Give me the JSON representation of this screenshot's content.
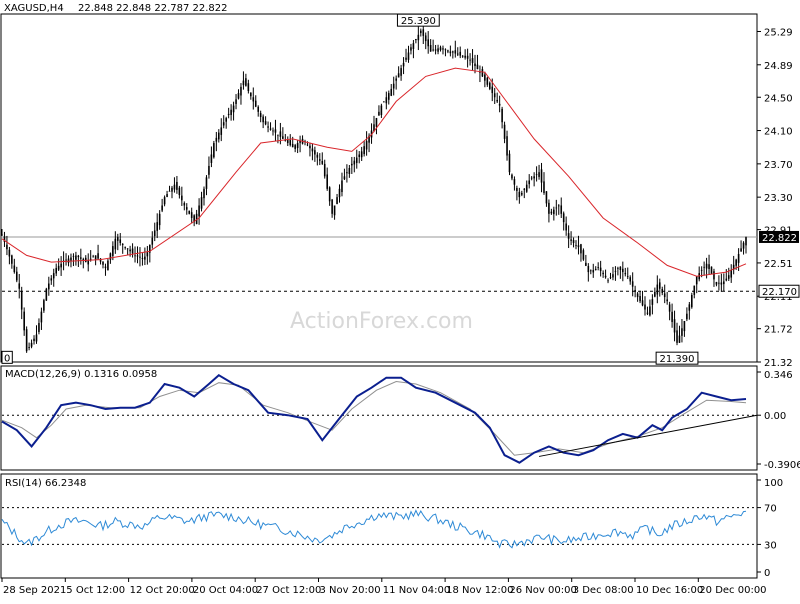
{
  "header": {
    "symbol": "XAGUSD,H4",
    "ohlc": "22.848 22.848 22.787 22.822"
  },
  "watermark": "ActionForex.com",
  "colors": {
    "candle": "#000000",
    "ma": "#d9262b",
    "macd_main": "#0b1f8f",
    "macd_signal": "#909090",
    "rsi": "#2e8ad6",
    "grid": "#808080",
    "trendline": "#000000",
    "last_price_box": "#000000"
  },
  "chart_data": [
    {
      "type": "candlestick",
      "name": "price",
      "title": "XAGUSD,H4",
      "ylim": [
        21.32,
        25.5
      ],
      "yticks": [
        25.29,
        24.89,
        24.5,
        24.1,
        23.7,
        23.3,
        22.91,
        22.51,
        22.11,
        21.72,
        21.32
      ],
      "xticks": [
        "28 Sep 2021",
        "5 Oct 12:00",
        "12 Oct 20:00",
        "20 Oct 04:00",
        "27 Oct 12:00",
        "3 Nov 20:00",
        "11 Nov 04:00",
        "18 Nov 12:00",
        "26 Nov 00:00",
        "3 Dec 08:00",
        "10 Dec 16:00",
        "20 Dec 00:00"
      ],
      "close_path": [
        [
          0,
          22.85
        ],
        [
          4,
          22.5
        ],
        [
          7,
          22.2
        ],
        [
          10,
          21.45
        ],
        [
          14,
          21.65
        ],
        [
          18,
          22.2
        ],
        [
          22,
          22.45
        ],
        [
          26,
          22.55
        ],
        [
          30,
          22.6
        ],
        [
          34,
          22.52
        ],
        [
          38,
          22.6
        ],
        [
          42,
          22.45
        ],
        [
          46,
          22.8
        ],
        [
          50,
          22.7
        ],
        [
          54,
          22.6
        ],
        [
          58,
          22.55
        ],
        [
          62,
          22.9
        ],
        [
          66,
          23.3
        ],
        [
          70,
          23.45
        ],
        [
          74,
          23.2
        ],
        [
          78,
          23.0
        ],
        [
          82,
          23.4
        ],
        [
          86,
          23.95
        ],
        [
          90,
          24.2
        ],
        [
          94,
          24.4
        ],
        [
          98,
          24.7
        ],
        [
          102,
          24.45
        ],
        [
          106,
          24.2
        ],
        [
          110,
          24.1
        ],
        [
          114,
          24.0
        ],
        [
          118,
          23.9
        ],
        [
          122,
          24.0
        ],
        [
          126,
          23.85
        ],
        [
          130,
          23.7
        ],
        [
          134,
          23.1
        ],
        [
          138,
          23.5
        ],
        [
          142,
          23.7
        ],
        [
          146,
          23.85
        ],
        [
          150,
          24.1
        ],
        [
          154,
          24.4
        ],
        [
          158,
          24.6
        ],
        [
          162,
          24.85
        ],
        [
          166,
          25.1
        ],
        [
          170,
          25.3
        ],
        [
          174,
          25.05
        ],
        [
          178,
          25.1
        ],
        [
          182,
          25.05
        ],
        [
          186,
          25.0
        ],
        [
          190,
          24.95
        ],
        [
          194,
          24.8
        ],
        [
          198,
          24.6
        ],
        [
          202,
          24.4
        ],
        [
          206,
          23.6
        ],
        [
          210,
          23.3
        ],
        [
          214,
          23.5
        ],
        [
          218,
          23.6
        ],
        [
          222,
          23.1
        ],
        [
          226,
          23.2
        ],
        [
          230,
          22.8
        ],
        [
          234,
          22.7
        ],
        [
          238,
          22.4
        ],
        [
          242,
          22.45
        ],
        [
          246,
          22.3
        ],
        [
          250,
          22.45
        ],
        [
          254,
          22.35
        ],
        [
          258,
          22.1
        ],
        [
          262,
          21.9
        ],
        [
          266,
          22.25
        ],
        [
          270,
          22.05
        ],
        [
          274,
          21.55
        ],
        [
          278,
          21.9
        ],
        [
          282,
          22.35
        ],
        [
          286,
          22.5
        ],
        [
          290,
          22.25
        ],
        [
          294,
          22.3
        ],
        [
          298,
          22.55
        ],
        [
          302,
          22.82
        ]
      ],
      "moving_average": [
        [
          0,
          22.8
        ],
        [
          10,
          22.6
        ],
        [
          20,
          22.52
        ],
        [
          40,
          22.55
        ],
        [
          60,
          22.65
        ],
        [
          80,
          23.05
        ],
        [
          95,
          23.6
        ],
        [
          105,
          23.95
        ],
        [
          118,
          24.0
        ],
        [
          132,
          23.9
        ],
        [
          142,
          23.85
        ],
        [
          150,
          24.05
        ],
        [
          160,
          24.45
        ],
        [
          172,
          24.75
        ],
        [
          184,
          24.85
        ],
        [
          196,
          24.8
        ],
        [
          206,
          24.4
        ],
        [
          216,
          24.0
        ],
        [
          230,
          23.55
        ],
        [
          244,
          23.05
        ],
        [
          258,
          22.75
        ],
        [
          270,
          22.48
        ],
        [
          282,
          22.35
        ],
        [
          294,
          22.4
        ],
        [
          302,
          22.5
        ]
      ],
      "labels": [
        {
          "text": "25.390",
          "x": 169,
          "y": 25.39
        },
        {
          "text": "21.390",
          "x": 274,
          "y": 21.39
        },
        {
          "text": "0",
          "x": 0,
          "y": 21.4
        }
      ],
      "hline": {
        "value": 22.17,
        "label": "22.170"
      },
      "last": {
        "value": 22.822,
        "label": "22.822"
      }
    },
    {
      "type": "line",
      "name": "macd",
      "title": "MACD(12,26,9) 0.1316 0.0958",
      "ylim": [
        -0.3906,
        0.346
      ],
      "yticks": [
        {
          "label": "0.346",
          "value": 0.346
        },
        {
          "label": "0.00",
          "value": 0.0
        },
        {
          "label": "-0.3906",
          "value": -0.3906
        }
      ],
      "main": [
        [
          0,
          -0.05
        ],
        [
          6,
          -0.12
        ],
        [
          12,
          -0.25
        ],
        [
          18,
          -0.1
        ],
        [
          24,
          0.08
        ],
        [
          30,
          0.1
        ],
        [
          36,
          0.08
        ],
        [
          42,
          0.05
        ],
        [
          48,
          0.06
        ],
        [
          54,
          0.06
        ],
        [
          60,
          0.1
        ],
        [
          66,
          0.25
        ],
        [
          72,
          0.22
        ],
        [
          78,
          0.15
        ],
        [
          84,
          0.25
        ],
        [
          88,
          0.32
        ],
        [
          94,
          0.25
        ],
        [
          100,
          0.2
        ],
        [
          108,
          0.02
        ],
        [
          116,
          0.0
        ],
        [
          124,
          -0.03
        ],
        [
          130,
          -0.2
        ],
        [
          136,
          -0.05
        ],
        [
          144,
          0.15
        ],
        [
          150,
          0.22
        ],
        [
          156,
          0.3
        ],
        [
          162,
          0.3
        ],
        [
          168,
          0.22
        ],
        [
          176,
          0.18
        ],
        [
          184,
          0.1
        ],
        [
          192,
          0.02
        ],
        [
          198,
          -0.1
        ],
        [
          204,
          -0.32
        ],
        [
          210,
          -0.38
        ],
        [
          216,
          -0.3
        ],
        [
          222,
          -0.25
        ],
        [
          228,
          -0.3
        ],
        [
          234,
          -0.32
        ],
        [
          240,
          -0.28
        ],
        [
          246,
          -0.2
        ],
        [
          252,
          -0.15
        ],
        [
          258,
          -0.18
        ],
        [
          264,
          -0.08
        ],
        [
          268,
          -0.12
        ],
        [
          272,
          -0.02
        ],
        [
          278,
          0.05
        ],
        [
          284,
          0.18
        ],
        [
          290,
          0.15
        ],
        [
          296,
          0.12
        ],
        [
          302,
          0.13
        ]
      ],
      "signal": [
        [
          0,
          -0.04
        ],
        [
          8,
          -0.1
        ],
        [
          14,
          -0.18
        ],
        [
          20,
          -0.08
        ],
        [
          26,
          0.05
        ],
        [
          34,
          0.08
        ],
        [
          44,
          0.06
        ],
        [
          56,
          0.06
        ],
        [
          64,
          0.15
        ],
        [
          72,
          0.2
        ],
        [
          80,
          0.18
        ],
        [
          88,
          0.26
        ],
        [
          96,
          0.24
        ],
        [
          106,
          0.08
        ],
        [
          116,
          0.02
        ],
        [
          126,
          -0.06
        ],
        [
          134,
          -0.12
        ],
        [
          142,
          0.05
        ],
        [
          152,
          0.2
        ],
        [
          160,
          0.27
        ],
        [
          168,
          0.25
        ],
        [
          178,
          0.18
        ],
        [
          190,
          0.05
        ],
        [
          200,
          -0.15
        ],
        [
          208,
          -0.32
        ],
        [
          216,
          -0.3
        ],
        [
          226,
          -0.27
        ],
        [
          236,
          -0.3
        ],
        [
          246,
          -0.23
        ],
        [
          258,
          -0.17
        ],
        [
          268,
          -0.1
        ],
        [
          276,
          0.0
        ],
        [
          286,
          0.12
        ],
        [
          296,
          0.11
        ],
        [
          302,
          0.1
        ]
      ],
      "trendline": [
        [
          218,
          -0.33
        ],
        [
          310,
          0.0
        ]
      ]
    },
    {
      "type": "line",
      "name": "rsi",
      "title": "RSI(14) 66.2348",
      "ylim": [
        0,
        100
      ],
      "yticks": [
        100,
        70,
        30,
        0
      ],
      "values": [
        [
          0,
          55
        ],
        [
          6,
          40
        ],
        [
          10,
          30
        ],
        [
          16,
          40
        ],
        [
          22,
          50
        ],
        [
          28,
          55
        ],
        [
          34,
          55
        ],
        [
          40,
          50
        ],
        [
          46,
          55
        ],
        [
          52,
          52
        ],
        [
          58,
          50
        ],
        [
          64,
          60
        ],
        [
          70,
          58
        ],
        [
          76,
          55
        ],
        [
          82,
          60
        ],
        [
          88,
          62
        ],
        [
          94,
          60
        ],
        [
          100,
          55
        ],
        [
          108,
          50
        ],
        [
          116,
          45
        ],
        [
          122,
          40
        ],
        [
          128,
          35
        ],
        [
          134,
          40
        ],
        [
          140,
          50
        ],
        [
          146,
          55
        ],
        [
          152,
          62
        ],
        [
          160,
          60
        ],
        [
          168,
          63
        ],
        [
          176,
          58
        ],
        [
          184,
          50
        ],
        [
          190,
          45
        ],
        [
          196,
          40
        ],
        [
          202,
          30
        ],
        [
          208,
          30
        ],
        [
          214,
          35
        ],
        [
          220,
          38
        ],
        [
          226,
          33
        ],
        [
          232,
          35
        ],
        [
          238,
          38
        ],
        [
          244,
          42
        ],
        [
          250,
          44
        ],
        [
          256,
          40
        ],
        [
          262,
          48
        ],
        [
          266,
          40
        ],
        [
          272,
          50
        ],
        [
          278,
          55
        ],
        [
          284,
          62
        ],
        [
          290,
          55
        ],
        [
          296,
          60
        ],
        [
          302,
          66
        ]
      ]
    }
  ]
}
